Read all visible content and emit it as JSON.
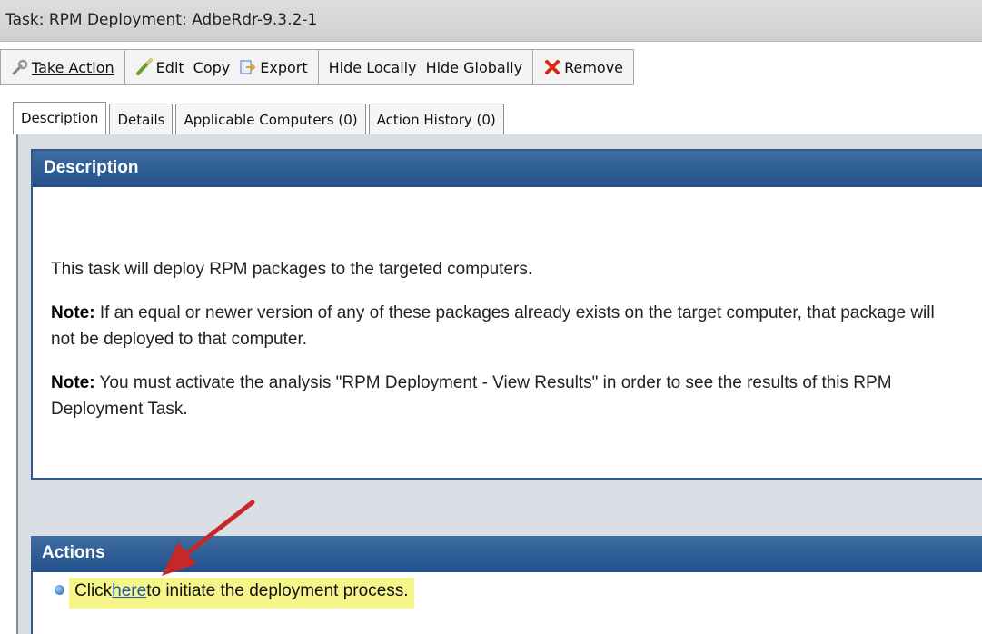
{
  "window": {
    "title": "Task: RPM Deployment: AdbeRdr-9.3.2-1"
  },
  "toolbar": {
    "take_action": "Take Action",
    "edit": "Edit",
    "copy": "Copy",
    "export": "Export",
    "hide_locally": "Hide Locally",
    "hide_globally": "Hide Globally",
    "remove": "Remove"
  },
  "tabs": [
    {
      "label": "Description",
      "active": true
    },
    {
      "label": "Details"
    },
    {
      "label": "Applicable Computers (0)"
    },
    {
      "label": "Action History (0)"
    }
  ],
  "description": {
    "header": "Description",
    "para1": "This task will deploy RPM packages to the targeted computers.",
    "note1_label": "Note:",
    "note1_text": " If an equal or newer version of any of these packages already exists on the target computer, that package will not be deployed to that computer.",
    "note2_label": "Note:",
    "note2_text": " You must activate the analysis \"RPM Deployment - View Results\" in order to see the results of this RPM Deployment Task."
  },
  "actions": {
    "header": "Actions",
    "prefix": "Click",
    "link": "here",
    "suffix": "to initiate the deployment process."
  },
  "colors": {
    "header_blue": "#2a5a94",
    "highlight": "#f5f58a",
    "arrow": "#c62828"
  },
  "icons": [
    "wrench-icon",
    "pencil-icon",
    "export-icon",
    "remove-x-icon",
    "bullet-icon"
  ]
}
